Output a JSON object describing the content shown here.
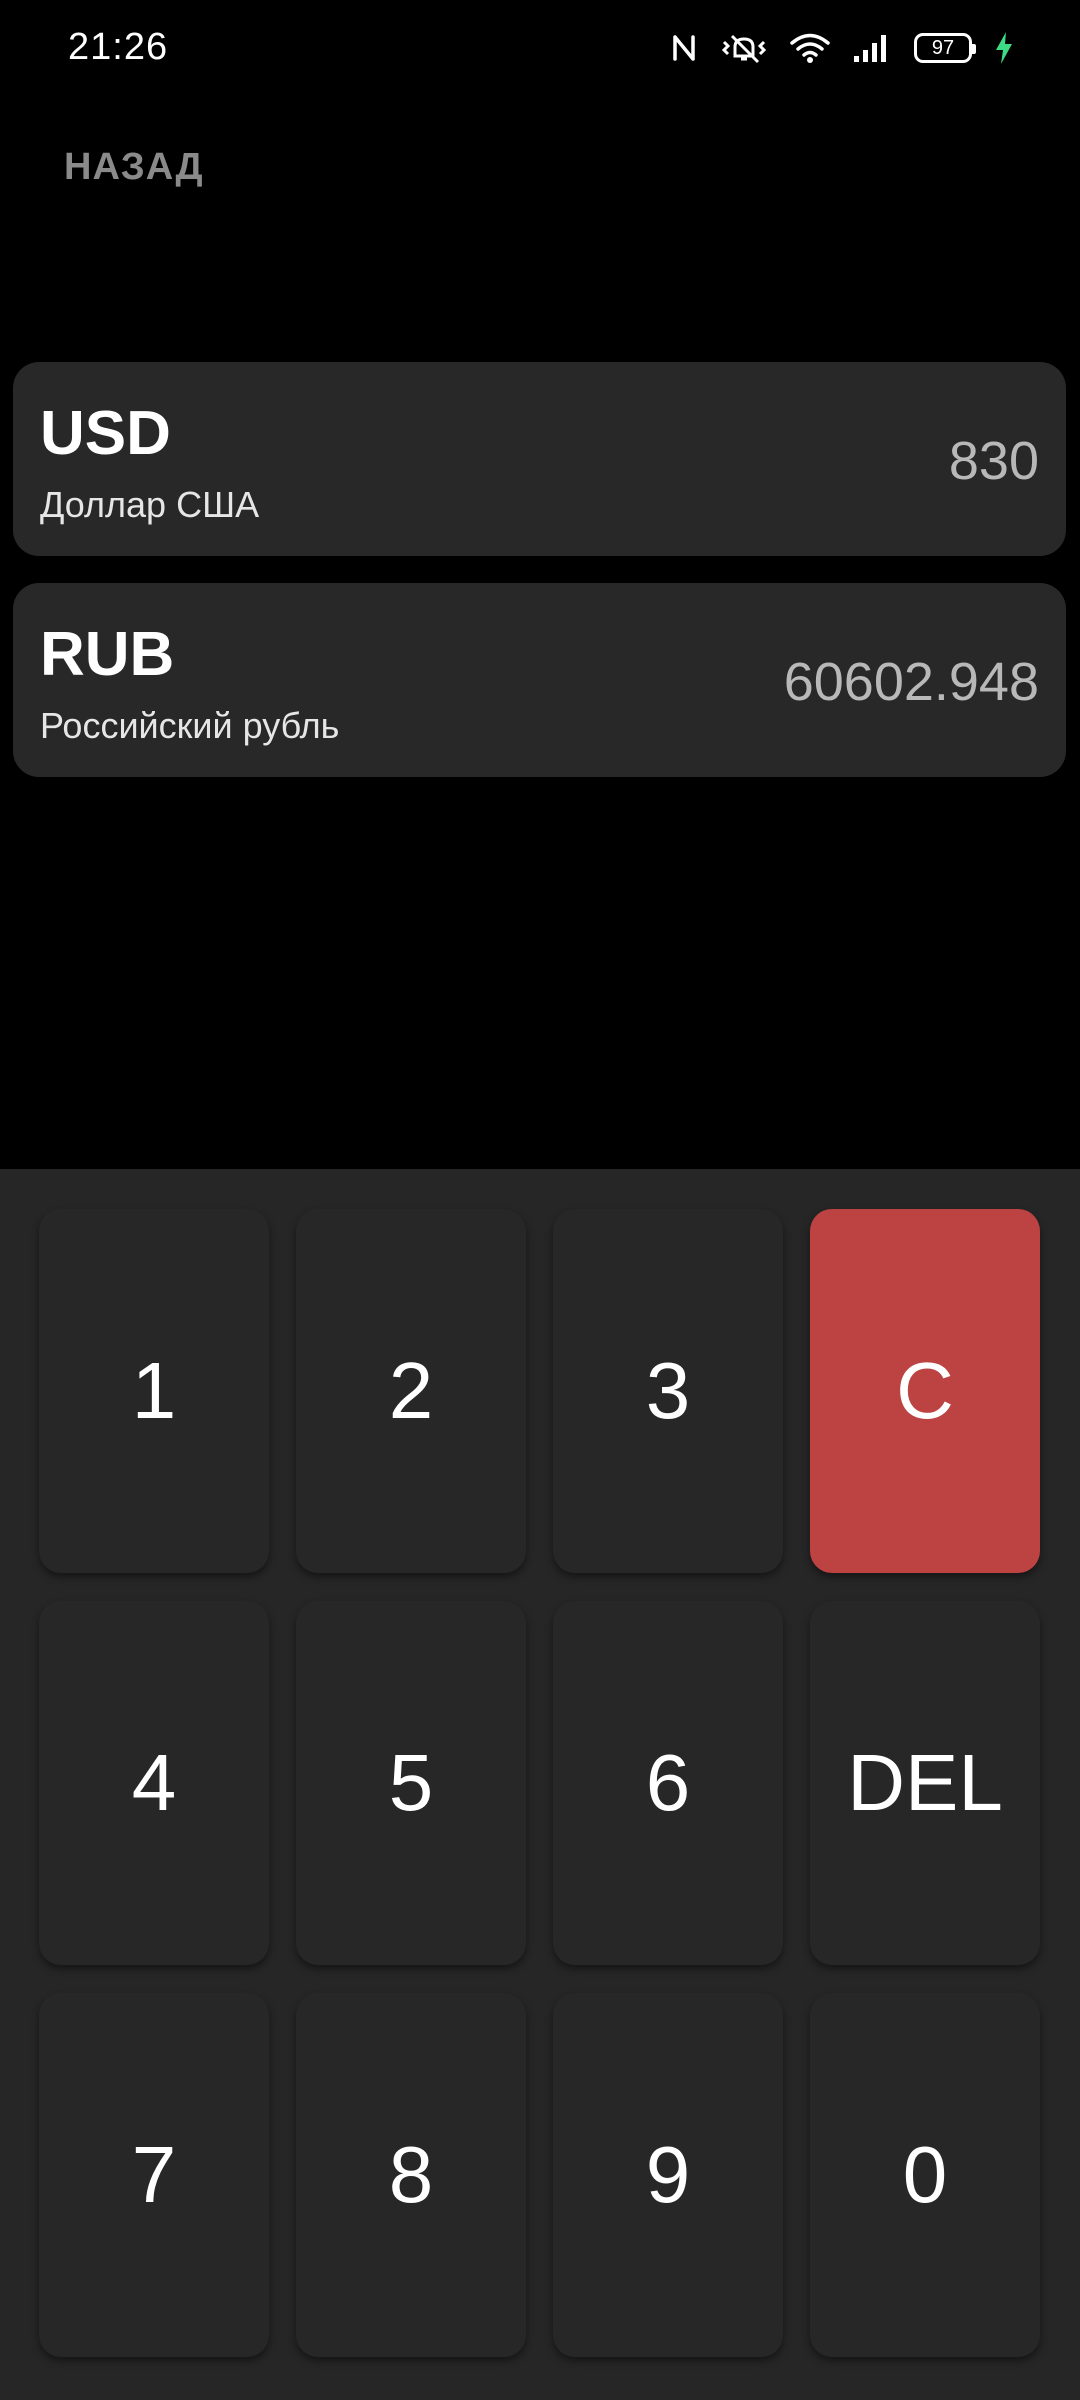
{
  "status_bar": {
    "time": "21:26",
    "battery_level": "97",
    "icons": [
      "nfc-icon",
      "vibrate-icon",
      "wifi-icon",
      "signal-icon",
      "battery-icon",
      "charging-icon"
    ],
    "charging_color": "#3ddc84"
  },
  "nav": {
    "back_label": "НАЗАД"
  },
  "currencies": [
    {
      "code": "USD",
      "name": "Доллар США",
      "amount": "830"
    },
    {
      "code": "RUB",
      "name": "Российский рубль",
      "amount": "60602.948"
    }
  ],
  "keypad": {
    "keys": [
      "1",
      "2",
      "3",
      "C",
      "4",
      "5",
      "6",
      "DEL",
      "7",
      "8",
      "9",
      "0"
    ],
    "clear_color": "#bd4242"
  }
}
